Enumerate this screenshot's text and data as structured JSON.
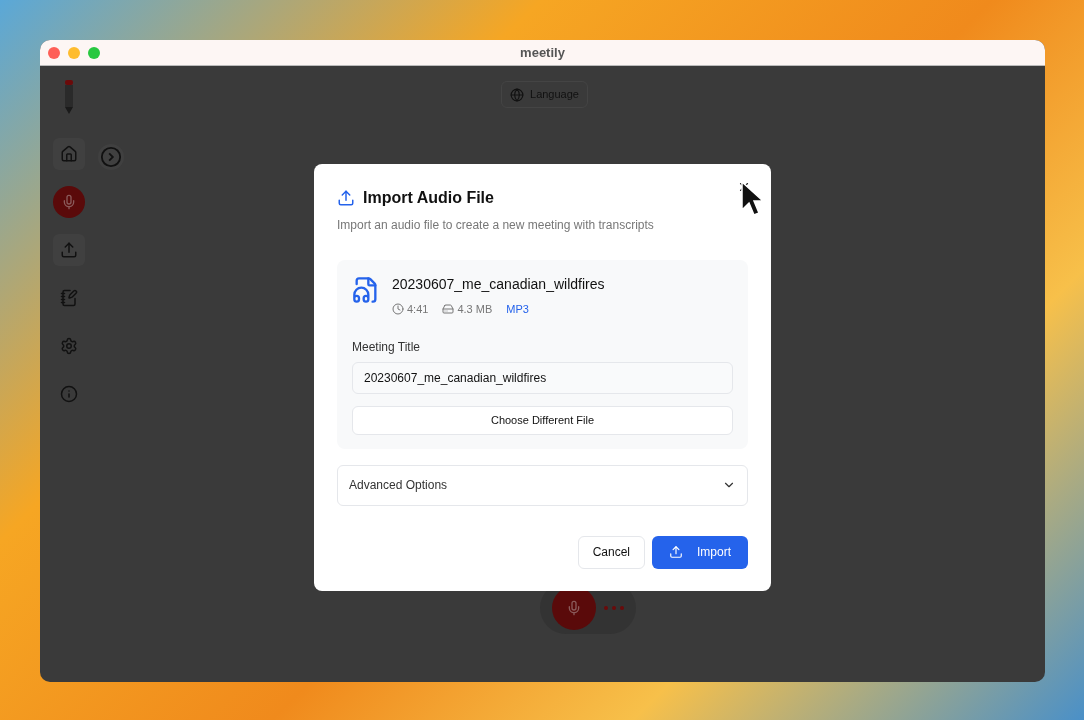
{
  "window": {
    "title": "meetily"
  },
  "toolbar": {
    "language_button": "Language"
  },
  "dialog": {
    "title": "Import Audio File",
    "subtitle": "Import an audio file to create a new meeting with transcripts",
    "file": {
      "name": "20230607_me_canadian_wildfires",
      "duration": "4:41",
      "size": "4.3 MB",
      "format": "MP3"
    },
    "meeting_title": {
      "label": "Meeting Title",
      "value": "20230607_me_canadian_wildfires"
    },
    "choose_button": "Choose Different File",
    "advanced_options": {
      "label": "Advanced Options",
      "expanded": false
    },
    "buttons": {
      "cancel": "Cancel",
      "import": "Import"
    }
  }
}
